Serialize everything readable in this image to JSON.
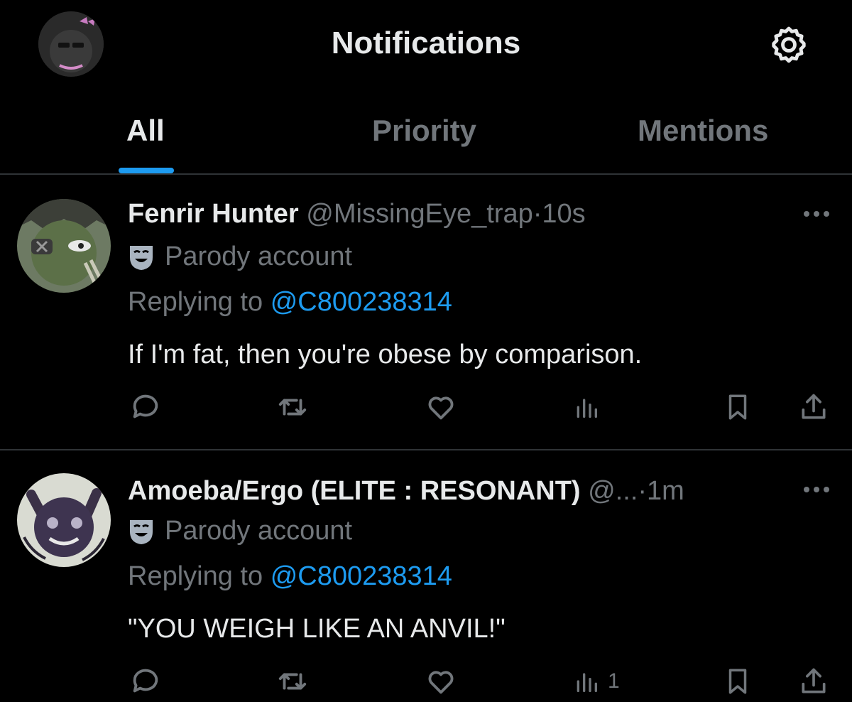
{
  "header": {
    "title": "Notifications",
    "avatar_icon": "user-avatar",
    "settings_icon": "gear-icon"
  },
  "tabs": [
    {
      "label": "All",
      "active": true
    },
    {
      "label": "Priority",
      "active": false
    },
    {
      "label": "Mentions",
      "active": false
    }
  ],
  "notifications": [
    {
      "name": "Fenrir Hunter",
      "handle": "@MissingEye_trap",
      "separator": "·",
      "time": "10s",
      "badge_label": "Parody account",
      "replying_prefix": "Replying to",
      "replying_handle": "@C800238314",
      "text": "If I'm fat, then you're obese by comparison.",
      "views": ""
    },
    {
      "name": "Amoeba/Ergo (ELITE : RESONANT)",
      "handle": "@...",
      "separator": "·",
      "time": "1m",
      "badge_label": "Parody account",
      "replying_prefix": "Replying to",
      "replying_handle": "@C800238314",
      "text": "\"YOU WEIGH LIKE AN ANVIL!\"",
      "views": "1"
    }
  ],
  "colors": {
    "accent": "#1d9bf0",
    "muted": "#71767b",
    "text": "#e7e9ea",
    "divider": "#2f3336",
    "background": "#000000"
  }
}
